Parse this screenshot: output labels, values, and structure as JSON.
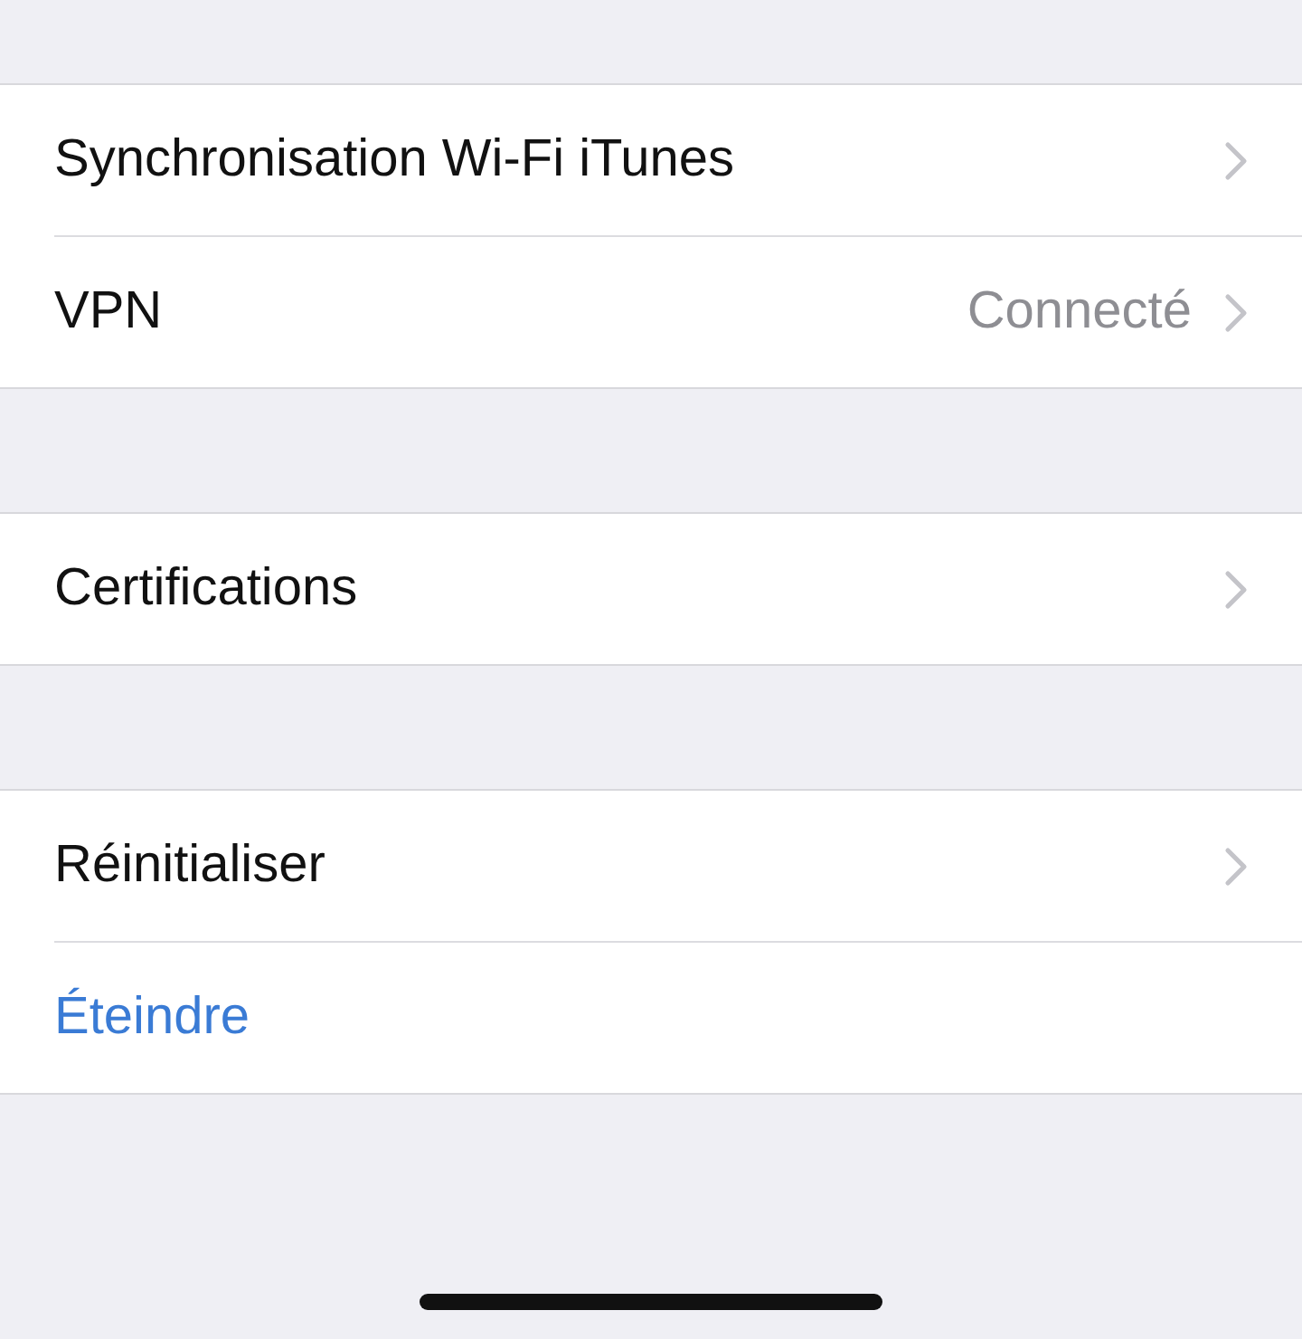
{
  "groups": [
    {
      "rows": [
        {
          "label": "Synchronisation Wi-Fi iTunes",
          "kind": "nav"
        },
        {
          "label": "VPN",
          "detail": "Connecté",
          "kind": "nav"
        }
      ]
    },
    {
      "rows": [
        {
          "label": "Certifications",
          "kind": "nav"
        }
      ]
    },
    {
      "rows": [
        {
          "label": "Réinitialiser",
          "kind": "nav"
        },
        {
          "label": "Éteindre",
          "kind": "action"
        }
      ]
    }
  ]
}
